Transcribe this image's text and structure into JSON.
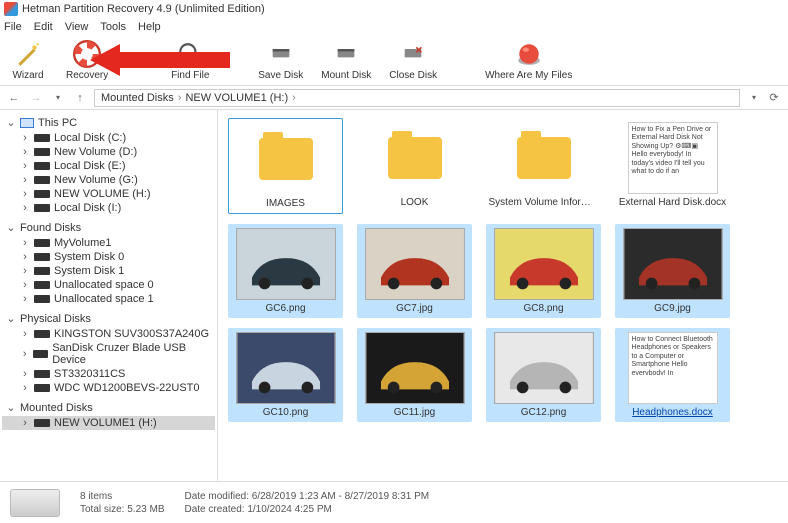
{
  "window": {
    "title": "Hetman Partition Recovery 4.9 (Unlimited Edition)"
  },
  "menu": {
    "file": "File",
    "edit": "Edit",
    "view": "View",
    "tools": "Tools",
    "help": "Help"
  },
  "toolbar": {
    "wizard": "Wizard",
    "recovery": "Recovery",
    "findfile": "Find File",
    "savedisk": "Save Disk",
    "mountdisk": "Mount Disk",
    "closedisk": "Close Disk",
    "wherefiles": "Where Are My Files"
  },
  "breadcrumb": {
    "root": "Mounted Disks",
    "path1": "NEW VOLUME1 (H:)"
  },
  "tree": {
    "thispc": {
      "label": "This PC",
      "items": [
        {
          "label": "Local Disk (C:)"
        },
        {
          "label": "New Volume (D:)"
        },
        {
          "label": "Local Disk (E:)"
        },
        {
          "label": "New Volume (G:)"
        },
        {
          "label": "NEW VOLUME (H:)"
        },
        {
          "label": "Local Disk (I:)"
        }
      ]
    },
    "found": {
      "label": "Found Disks",
      "items": [
        {
          "label": "MyVolume1"
        },
        {
          "label": "System Disk 0"
        },
        {
          "label": "System Disk 1"
        },
        {
          "label": "Unallocated space 0"
        },
        {
          "label": "Unallocated space 1"
        }
      ]
    },
    "physical": {
      "label": "Physical Disks",
      "items": [
        {
          "label": "KINGSTON SUV300S37A240G"
        },
        {
          "label": "SanDisk Cruzer Blade USB Device"
        },
        {
          "label": "ST3320311CS"
        },
        {
          "label": "WDC WD1200BEVS-22UST0"
        }
      ]
    },
    "mounted": {
      "label": "Mounted Disks",
      "items": [
        {
          "label": "NEW VOLUME1 (H:)"
        }
      ]
    }
  },
  "files": {
    "row1": [
      {
        "name": "IMAGES",
        "type": "folder"
      },
      {
        "name": "LOOK",
        "type": "folder"
      },
      {
        "name": "System Volume Information",
        "type": "folder"
      },
      {
        "name": "External Hard Disk.docx",
        "type": "doc",
        "preview": "How to Fix a Pen Drive or External Hard Disk Not Showing Up? ⚙⌨▣\n\nHello everybody! In today's video I'll tell you what to do if an"
      }
    ],
    "row2": [
      {
        "name": "GC6.png",
        "type": "img",
        "colors": [
          "#c9d4db",
          "#2b3a42"
        ]
      },
      {
        "name": "GC7.jpg",
        "type": "img",
        "colors": [
          "#d9d2c5",
          "#b0341f"
        ]
      },
      {
        "name": "GC8.png",
        "type": "img",
        "colors": [
          "#e6d96b",
          "#c73a2b"
        ]
      },
      {
        "name": "GC9.jpg",
        "type": "img",
        "colors": [
          "#2b2b2b",
          "#a33326"
        ]
      }
    ],
    "row3": [
      {
        "name": "GC10.png",
        "type": "img",
        "colors": [
          "#3b4a6b",
          "#c8d4e0"
        ]
      },
      {
        "name": "GC11.jpg",
        "type": "img",
        "colors": [
          "#1a1a1a",
          "#d4a437"
        ]
      },
      {
        "name": "GC12.png",
        "type": "img",
        "colors": [
          "#e8e8e8",
          "#b5b5b5"
        ]
      },
      {
        "name": "Headphones.docx",
        "type": "doc",
        "preview": "How to Connect Bluetooth Headphones or Speakers to a Computer or Smartphone\n\nHello evervbodv! In"
      }
    ]
  },
  "status": {
    "items_label": "8 items",
    "size_label": "Total size:",
    "size_value": "5.23 MB",
    "modified_label": "Date modified:",
    "modified_value": "6/28/2019 1:23 AM - 8/27/2019 8:31 PM",
    "created_label": "Date created:",
    "created_value": "1/10/2024 4:25 PM"
  }
}
